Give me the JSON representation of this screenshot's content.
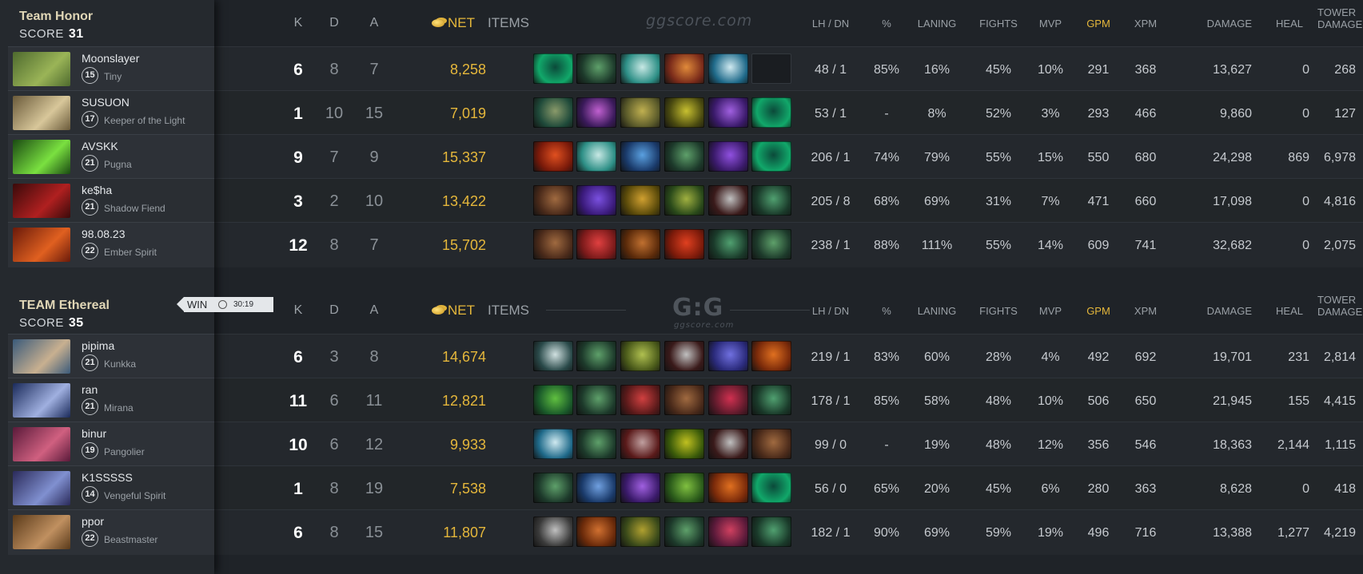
{
  "colors": {
    "accent_gold": "#e5b73b",
    "team_name": "#e0d6b6",
    "background": "#1f2328"
  },
  "watermark": {
    "top": "ggscore.com",
    "logo": "G:G",
    "logo_sub": "ggscore.com"
  },
  "header_labels": {
    "k": "K",
    "d": "D",
    "a": "A",
    "net": "NET",
    "items": "ITEMS",
    "lhdn": "LH / DN",
    "pct": "%",
    "laning": "LANING",
    "fights": "FIGHTS",
    "mvp": "MVP",
    "gpm": "GPM",
    "xpm": "XPM",
    "damage": "DAMAGE",
    "heal": "HEAL",
    "tower1": "TOWER",
    "tower2": "DAMAGE",
    "gold_icon": "gold-coins-icon"
  },
  "result": {
    "label": "WIN",
    "time": "30:19",
    "icon": "clock-icon"
  },
  "teams": [
    {
      "name": "Team Honor",
      "score_label": "SCORE",
      "score": "31",
      "players": [
        {
          "name": "Moonslayer",
          "level": "15",
          "hero": "Tiny",
          "portrait": [
            "#4e6a2e",
            "#9ab457"
          ],
          "k": "6",
          "d": "8",
          "a": "7",
          "net": "8,258",
          "items": [
            [
              "#11a86a",
              "#0b4a3a"
            ],
            [
              "#1d3a2b",
              "#5ea06a"
            ],
            [
              "#2d8f86",
              "#c7e8e4"
            ],
            [
              "#7a2b1a",
              "#e08a3a"
            ],
            [
              "#1f6a8a",
              "#cfe9f0"
            ],
            null
          ],
          "lhdn": "48 / 1",
          "pct": "85%",
          "laning": "16%",
          "fights": "45%",
          "mvp": "10%",
          "gpm": "291",
          "xpm": "368",
          "damage": "13,627",
          "heal": "0",
          "tower": "268"
        },
        {
          "name": "SUSUON",
          "level": "17",
          "hero": "Keeper of the Light",
          "portrait": [
            "#6a5a3a",
            "#d8c79a"
          ],
          "k": "1",
          "d": "10",
          "a": "15",
          "net": "7,019",
          "items": [
            [
              "#1f4a3a",
              "#8a9a6a"
            ],
            [
              "#3a1a5a",
              "#c060d0"
            ],
            [
              "#5a5a2a",
              "#c0b050"
            ],
            [
              "#4a4a10",
              "#c8c030"
            ],
            [
              "#3a1a6a",
              "#a060e0"
            ],
            [
              "#11a86a",
              "#0b4a3a"
            ]
          ],
          "lhdn": "53 / 1",
          "pct": "-",
          "laning": "8%",
          "fights": "52%",
          "mvp": "3%",
          "gpm": "293",
          "xpm": "466",
          "damage": "9,860",
          "heal": "0",
          "tower": "127"
        },
        {
          "name": "AVSKK",
          "level": "21",
          "hero": "Pugna",
          "portrait": [
            "#1a4a12",
            "#7ae040"
          ],
          "k": "9",
          "d": "7",
          "a": "9",
          "net": "15,337",
          "items": [
            [
              "#7a1a0a",
              "#e05020"
            ],
            [
              "#2d8f86",
              "#c7e8e4"
            ],
            [
              "#1a3a6a",
              "#5aa0e0"
            ],
            [
              "#1d3a2b",
              "#5ea06a"
            ],
            [
              "#3a1a6a",
              "#9050e0"
            ],
            [
              "#11a86a",
              "#0b4a3a"
            ]
          ],
          "lhdn": "206 / 1",
          "pct": "74%",
          "laning": "79%",
          "fights": "55%",
          "mvp": "15%",
          "gpm": "550",
          "xpm": "680",
          "damage": "24,298",
          "heal": "869",
          "tower": "6,978"
        },
        {
          "name": "ke$ha",
          "level": "21",
          "hero": "Shadow Fiend",
          "portrait": [
            "#3a0a0a",
            "#b02020"
          ],
          "k": "3",
          "d": "2",
          "a": "10",
          "net": "13,422",
          "items": [
            [
              "#4a2a1a",
              "#a06a40"
            ],
            [
              "#3a1a7a",
              "#7a50e0"
            ],
            [
              "#5a4a0a",
              "#d0a030"
            ],
            [
              "#2a4a1a",
              "#a0b040"
            ],
            [
              "#3a1a1a",
              "#c0c0c0"
            ],
            [
              "#1a3a2a",
              "#50a070"
            ]
          ],
          "lhdn": "205 / 8",
          "pct": "68%",
          "laning": "69%",
          "fights": "31%",
          "mvp": "7%",
          "gpm": "471",
          "xpm": "660",
          "damage": "17,098",
          "heal": "0",
          "tower": "4,816"
        },
        {
          "name": "98.08.23",
          "level": "22",
          "hero": "Ember Spirit",
          "portrait": [
            "#6a1a0a",
            "#e06020"
          ],
          "k": "12",
          "d": "8",
          "a": "7",
          "net": "15,702",
          "items": [
            [
              "#4a2a1a",
              "#a06a40"
            ],
            [
              "#7a1a1a",
              "#e04040"
            ],
            [
              "#5a2a0a",
              "#c07030"
            ],
            [
              "#7a1a0a",
              "#e04020"
            ],
            [
              "#1a3a2a",
              "#50a070"
            ],
            [
              "#1d3a2b",
              "#5ea06a"
            ]
          ],
          "lhdn": "238 / 1",
          "pct": "88%",
          "laning": "111%",
          "fights": "55%",
          "mvp": "14%",
          "gpm": "609",
          "xpm": "741",
          "damage": "32,682",
          "heal": "0",
          "tower": "2,075"
        }
      ]
    },
    {
      "name": "TEAM Ethereal",
      "score_label": "SCORE",
      "score": "35",
      "players": [
        {
          "name": "pipima",
          "level": "21",
          "hero": "Kunkka",
          "portrait": [
            "#3a5a7a",
            "#c8b090"
          ],
          "k": "6",
          "d": "3",
          "a": "8",
          "net": "14,674",
          "items": [
            [
              "#2a4a4a",
              "#d0e0e0"
            ],
            [
              "#1d3a2b",
              "#5ea06a"
            ],
            [
              "#4a5a1a",
              "#b0c050"
            ],
            [
              "#3a1a1a",
              "#c0c0c0"
            ],
            [
              "#2a2a7a",
              "#7070e0"
            ],
            [
              "#7a2a0a",
              "#e07020"
            ]
          ],
          "lhdn": "219 / 1",
          "pct": "83%",
          "laning": "60%",
          "fights": "28%",
          "mvp": "4%",
          "gpm": "492",
          "xpm": "692",
          "damage": "19,701",
          "heal": "231",
          "tower": "2,814"
        },
        {
          "name": "ran",
          "level": "21",
          "hero": "Mirana",
          "portrait": [
            "#1a2a5a",
            "#a0b0e0"
          ],
          "k": "11",
          "d": "6",
          "a": "11",
          "net": "12,821",
          "items": [
            [
              "#1a5a2a",
              "#60c040"
            ],
            [
              "#1d3a2b",
              "#5ea06a"
            ],
            [
              "#5a1a1a",
              "#d04040"
            ],
            [
              "#4a2a1a",
              "#a06a40"
            ],
            [
              "#5a1a2a",
              "#d03050"
            ],
            [
              "#1a3a2a",
              "#50a070"
            ]
          ],
          "lhdn": "178 / 1",
          "pct": "85%",
          "laning": "58%",
          "fights": "48%",
          "mvp": "10%",
          "gpm": "506",
          "xpm": "650",
          "damage": "21,945",
          "heal": "155",
          "tower": "4,415"
        },
        {
          "name": "binur",
          "level": "19",
          "hero": "Pangolier",
          "portrait": [
            "#5a1a3a",
            "#d06080"
          ],
          "k": "10",
          "d": "6",
          "a": "12",
          "net": "9,933",
          "items": [
            [
              "#1f6a8a",
              "#cfe9f0"
            ],
            [
              "#1d3a2b",
              "#5ea06a"
            ],
            [
              "#5a1a1a",
              "#c0a0a0"
            ],
            [
              "#3a5a0a",
              "#c0c020"
            ],
            [
              "#3a1a1a",
              "#c0c0c0"
            ],
            [
              "#4a2a1a",
              "#a06a40"
            ]
          ],
          "lhdn": "99 / 0",
          "pct": "-",
          "laning": "19%",
          "fights": "48%",
          "mvp": "12%",
          "gpm": "356",
          "xpm": "546",
          "damage": "18,363",
          "heal": "2,144",
          "tower": "1,115"
        },
        {
          "name": "K1SSSSS",
          "level": "14",
          "hero": "Vengeful Spirit",
          "portrait": [
            "#2a2a5a",
            "#8090d0"
          ],
          "k": "1",
          "d": "8",
          "a": "19",
          "net": "7,538",
          "items": [
            [
              "#1d3a2b",
              "#5ea06a"
            ],
            [
              "#1a3a6a",
              "#70a0e0"
            ],
            [
              "#3a1a6a",
              "#a060e0"
            ],
            [
              "#2a5a1a",
              "#80c040"
            ],
            [
              "#7a2a0a",
              "#e07020"
            ],
            [
              "#11a86a",
              "#0b4a3a"
            ]
          ],
          "lhdn": "56 / 0",
          "pct": "65%",
          "laning": "20%",
          "fights": "45%",
          "mvp": "6%",
          "gpm": "280",
          "xpm": "363",
          "damage": "8,628",
          "heal": "0",
          "tower": "418"
        },
        {
          "name": "ppor",
          "level": "22",
          "hero": "Beastmaster",
          "portrait": [
            "#5a3a1a",
            "#c09060"
          ],
          "k": "6",
          "d": "8",
          "a": "15",
          "net": "11,807",
          "items": [
            [
              "#3a3a3a",
              "#c0c0c0"
            ],
            [
              "#6a2a0a",
              "#d07030"
            ],
            [
              "#3a4a1a",
              "#b0a030"
            ],
            [
              "#1d3a2b",
              "#5ea06a"
            ],
            [
              "#5a1a3a",
              "#d04060"
            ],
            [
              "#1a3a2a",
              "#50a070"
            ]
          ],
          "lhdn": "182 / 1",
          "pct": "90%",
          "laning": "69%",
          "fights": "59%",
          "mvp": "19%",
          "gpm": "496",
          "xpm": "716",
          "damage": "13,388",
          "heal": "1,277",
          "tower": "4,219"
        }
      ]
    }
  ]
}
